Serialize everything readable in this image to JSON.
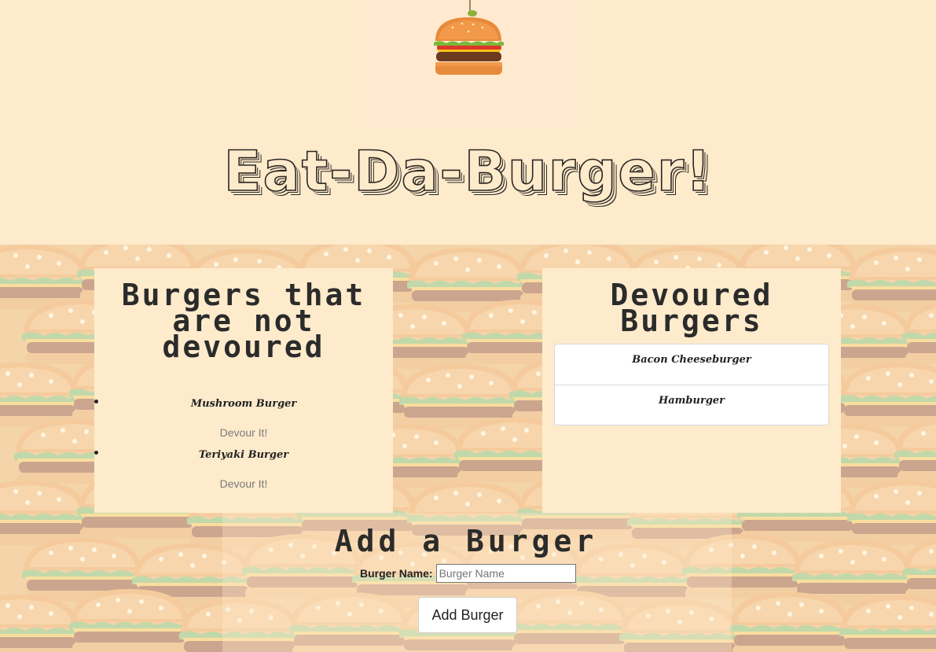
{
  "header": {
    "title": "Eat-Da-Burger!"
  },
  "undevoured": {
    "heading": "Burgers that are not devoured",
    "items": [
      {
        "name": "Mushroom Burger",
        "button_label": "Devour It!"
      },
      {
        "name": "Teriyaki Burger",
        "button_label": "Devour It!"
      }
    ]
  },
  "devoured": {
    "heading": "Devoured Burgers",
    "items": [
      {
        "name": "Bacon Cheeseburger"
      },
      {
        "name": "Hamburger"
      }
    ]
  },
  "add_form": {
    "heading": "Add a Burger",
    "label": "Burger Name:",
    "placeholder": "Burger Name",
    "button_label": "Add Burger"
  },
  "colors": {
    "page_bg": "#feebcc",
    "text_dark": "#2b2b2b"
  },
  "icons": {
    "logo": "burger-icon"
  }
}
